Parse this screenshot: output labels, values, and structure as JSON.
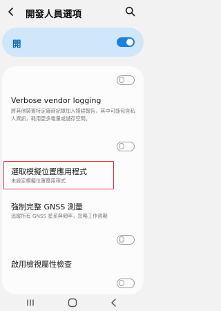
{
  "header": {
    "title": "開發人員選項",
    "back_icon": "chevron-left-icon",
    "search_icon": "search-icon"
  },
  "master_switch": {
    "label": "開",
    "state": "on"
  },
  "items": [
    {
      "title": "",
      "subtitle": "",
      "toggle": "off"
    },
    {
      "title": "Verbose vendor logging",
      "subtitle": "將其他裝置特定廠商記錄加入錯誤報告，其中可能包含私人資訊，耗用更多電量或儲存空間。",
      "toggle": "off"
    },
    {
      "title": "選取模擬位置應用程式",
      "subtitle": "未設定模擬位置應用程式"
    },
    {
      "title": "強制完整 GNSS 測量",
      "subtitle": "追蹤所有 GNSS 星系與頻率，忽略工作週期",
      "toggle": "off"
    },
    {
      "title": "啟用檢視屬性檢查",
      "toggle": "off"
    }
  ],
  "nav": {
    "recent": "recent-apps-icon",
    "home": "home-icon",
    "back": "back-icon"
  },
  "colors": {
    "accent": "#1f7fde",
    "master_bg": "#cfe6fb",
    "highlight": "#e0303a"
  }
}
